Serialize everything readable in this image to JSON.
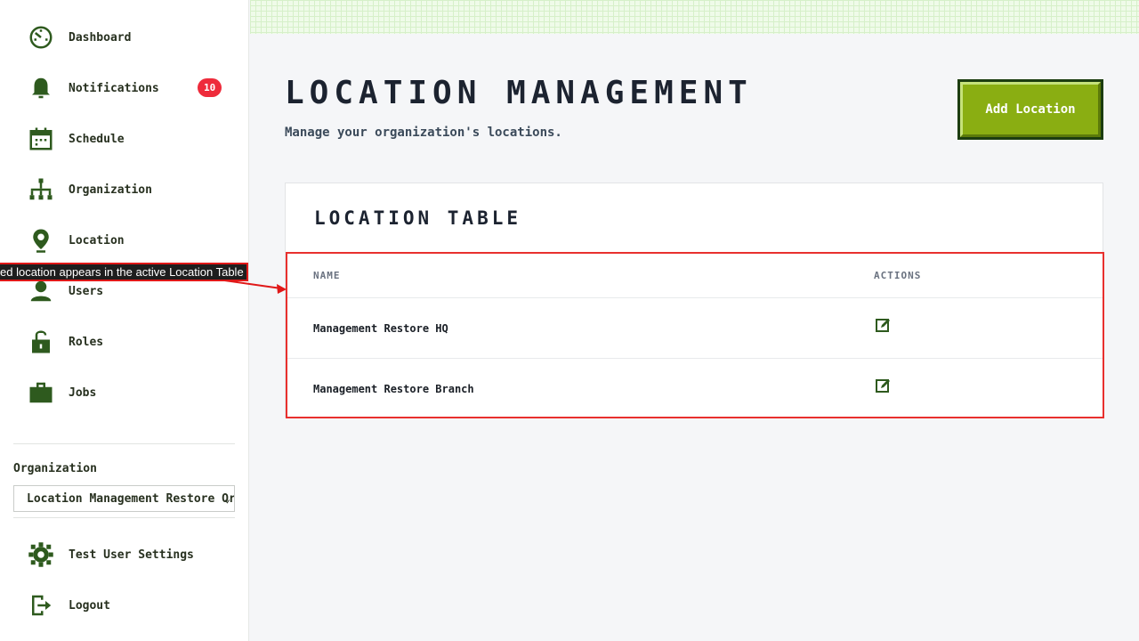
{
  "sidebar": {
    "items": [
      {
        "label": "Dashboard",
        "icon": "dashboard-icon"
      },
      {
        "label": "Notifications",
        "icon": "bell-icon",
        "badge": "10"
      },
      {
        "label": "Schedule",
        "icon": "calendar-icon"
      },
      {
        "label": "Organization",
        "icon": "org-chart-icon"
      },
      {
        "label": "Location",
        "icon": "map-pin-icon"
      },
      {
        "label": "Users",
        "icon": "user-icon"
      },
      {
        "label": "Roles",
        "icon": "lock-icon"
      },
      {
        "label": "Jobs",
        "icon": "briefcase-icon"
      }
    ],
    "organization": {
      "label": "Organization",
      "selected": "Location Management Restore Org"
    },
    "bottom": [
      {
        "label": "Test User Settings",
        "icon": "gear-icon"
      },
      {
        "label": "Logout",
        "icon": "logout-icon"
      }
    ]
  },
  "main": {
    "title": "Location Management",
    "subtitle": "Manage your organization's locations.",
    "add_button": "Add Location",
    "card_title": "Location Table",
    "table": {
      "headers": [
        "NAME",
        "ACTIONS"
      ],
      "rows": [
        {
          "name": "Management Restore HQ"
        },
        {
          "name": "Management Restore Branch"
        }
      ]
    }
  },
  "annotation": {
    "text": "ed location appears in the active Location Table"
  },
  "colors": {
    "accent": "#8aae12",
    "accent_dark": "#1c3d10",
    "icon": "#2e5a1e",
    "badge": "#ee2b3b",
    "highlight": "#e8302e"
  }
}
